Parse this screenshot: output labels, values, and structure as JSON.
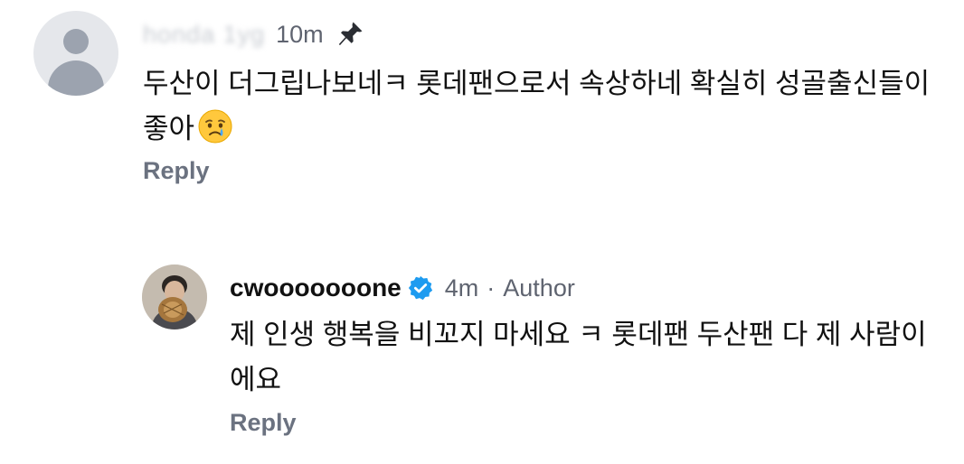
{
  "comments": [
    {
      "username_blurred": "honda 1yg",
      "time": "10m",
      "pinned": true,
      "avatar": "default-avatar",
      "text": "두산이 더그립나보네ㅋ 롯데팬으로서 속상하네 확실히 성골출신들이 좋아",
      "emoji": "crying-face",
      "reply_label": "Reply"
    },
    {
      "username": "cwooooooone",
      "verified": true,
      "time": "4m",
      "separator": "·",
      "badge": "Author",
      "avatar": "profile-photo",
      "text": "제 인생 행복을 비꼬지 마세요 ㅋ 롯데팬 두산팬 다 제 사람이에요",
      "reply_label": "Reply"
    }
  ],
  "colors": {
    "text_primary": "#111111",
    "text_secondary": "#5f6470",
    "reply": "#6b7280",
    "verified_blue": "#1d9bf0",
    "avatar_bg": "#e5e7eb",
    "avatar_fg": "#9ca3af"
  }
}
